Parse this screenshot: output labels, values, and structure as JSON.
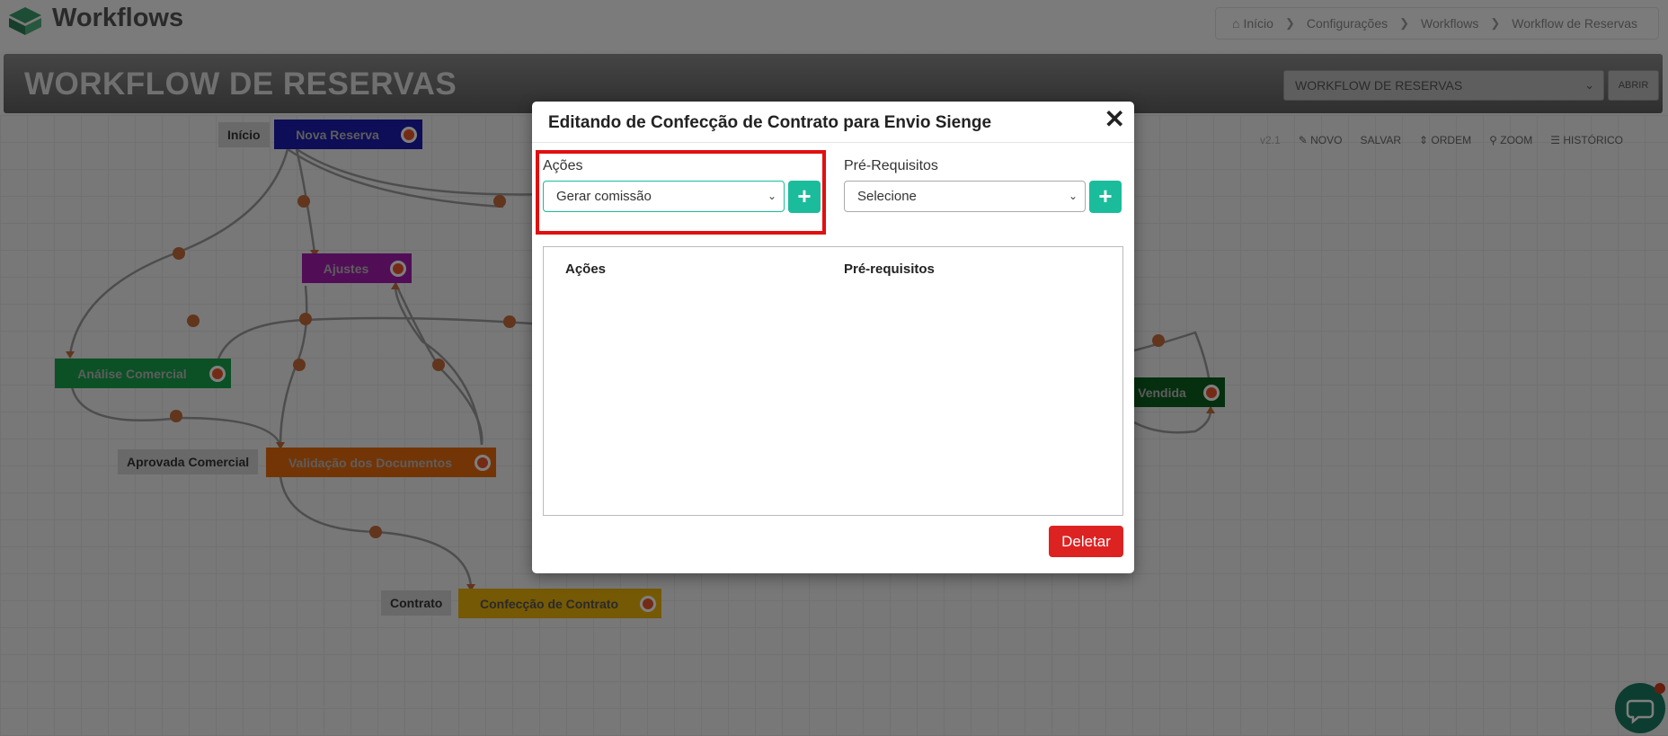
{
  "app": {
    "title": "Workflows"
  },
  "breadcrumb": [
    "Início",
    "Configurações",
    "Workflows",
    "Workflow de Reservas"
  ],
  "page": {
    "title": "WORKFLOW DE RESERVAS",
    "workflow_select": "WORKFLOW DE RESERVAS",
    "open_button": "ABRIR"
  },
  "toolbar": {
    "version": "v2.1",
    "new": "NOVO",
    "save": "SALVAR",
    "order": "ORDEM",
    "zoom": "ZOOM",
    "history": "HISTÓRICO"
  },
  "tags": {
    "inicio": "Início",
    "aprovada_comercial": "Aprovada Comercial",
    "contrato": "Contrato"
  },
  "nodes": {
    "nova_reserva": "Nova Reserva",
    "ajustes": "Ajustes",
    "analise_comercial": "Análise Comercial",
    "validacao_documentos": "Validação dos Documentos",
    "confeccao_contrato": "Confecção de Contrato",
    "vendida": "Vendida"
  },
  "modal": {
    "title": "Editando de Confecção de Contrato para Envio Sienge",
    "actions_label": "Ações",
    "actions_selected": "Gerar comissão",
    "prereq_label": "Pré-Requisitos",
    "prereq_selected": "Selecione",
    "table_headers": [
      "Ações",
      "Pré-requisitos"
    ],
    "delete_button": "Deletar"
  },
  "colors": {
    "accent": "#1abc9c",
    "delete": "#dd2222",
    "highlight": "#e01010",
    "node_nova_reserva": "#1a1ab0",
    "node_ajustes": "#a21caf",
    "node_analise": "#16a34a",
    "node_validacao": "#e86a0c",
    "node_confeccao": "#eab308",
    "node_vendida": "#0b5e1e"
  },
  "icons": [
    "logo-icon",
    "home-icon",
    "chevron-right-icon",
    "pencil-icon",
    "sort-icon",
    "search-icon",
    "list-icon",
    "close-icon",
    "plus-icon",
    "chevron-down-icon",
    "chat-icon"
  ]
}
